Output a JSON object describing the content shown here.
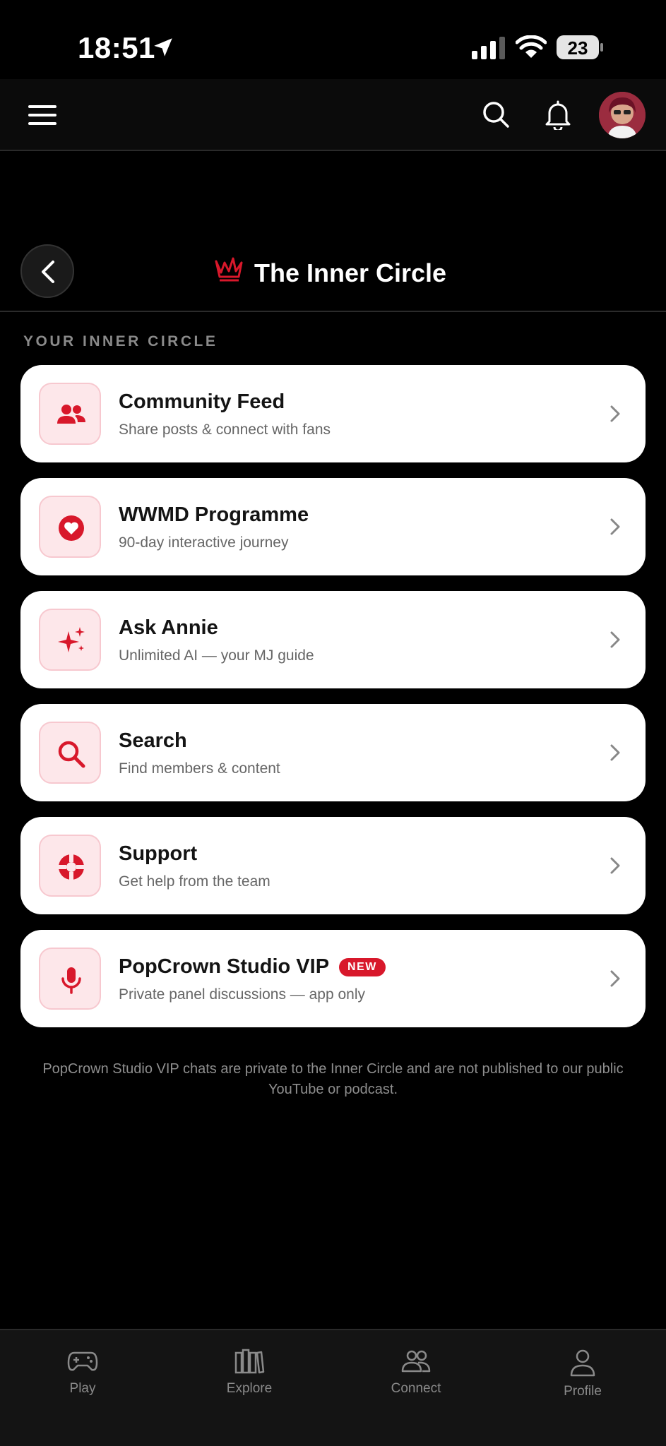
{
  "status_bar": {
    "time": "18:51",
    "battery": "23"
  },
  "header": {
    "title": "The Inner Circle"
  },
  "section_label": "YOUR INNER CIRCLE",
  "cards": [
    {
      "title": "Community Feed",
      "subtitle": "Share posts & connect with fans",
      "icon": "people-icon"
    },
    {
      "title": "WWMD Programme",
      "subtitle": "90-day interactive journey",
      "icon": "heart-icon"
    },
    {
      "title": "Ask Annie",
      "subtitle": "Unlimited AI — your MJ guide",
      "icon": "sparkles-icon"
    },
    {
      "title": "Search",
      "subtitle": "Find members & content",
      "icon": "search-icon"
    },
    {
      "title": "Support",
      "subtitle": "Get help from the team",
      "icon": "lifebuoy-icon"
    },
    {
      "title": "PopCrown Studio VIP",
      "subtitle": "Private panel discussions — app only",
      "icon": "microphone-icon",
      "badge": "NEW"
    }
  ],
  "footnote": "PopCrown Studio VIP chats are private to the Inner Circle and are not published to our public YouTube or podcast.",
  "bottom_nav": [
    {
      "label": "Play",
      "icon": "gamepad-icon"
    },
    {
      "label": "Explore",
      "icon": "library-icon"
    },
    {
      "label": "Connect",
      "icon": "people-outline-icon"
    },
    {
      "label": "Profile",
      "icon": "person-icon"
    }
  ],
  "colors": {
    "accent": "#d8182b",
    "icon_bg": "#fde7ea",
    "background": "#000000",
    "card": "#ffffff"
  }
}
